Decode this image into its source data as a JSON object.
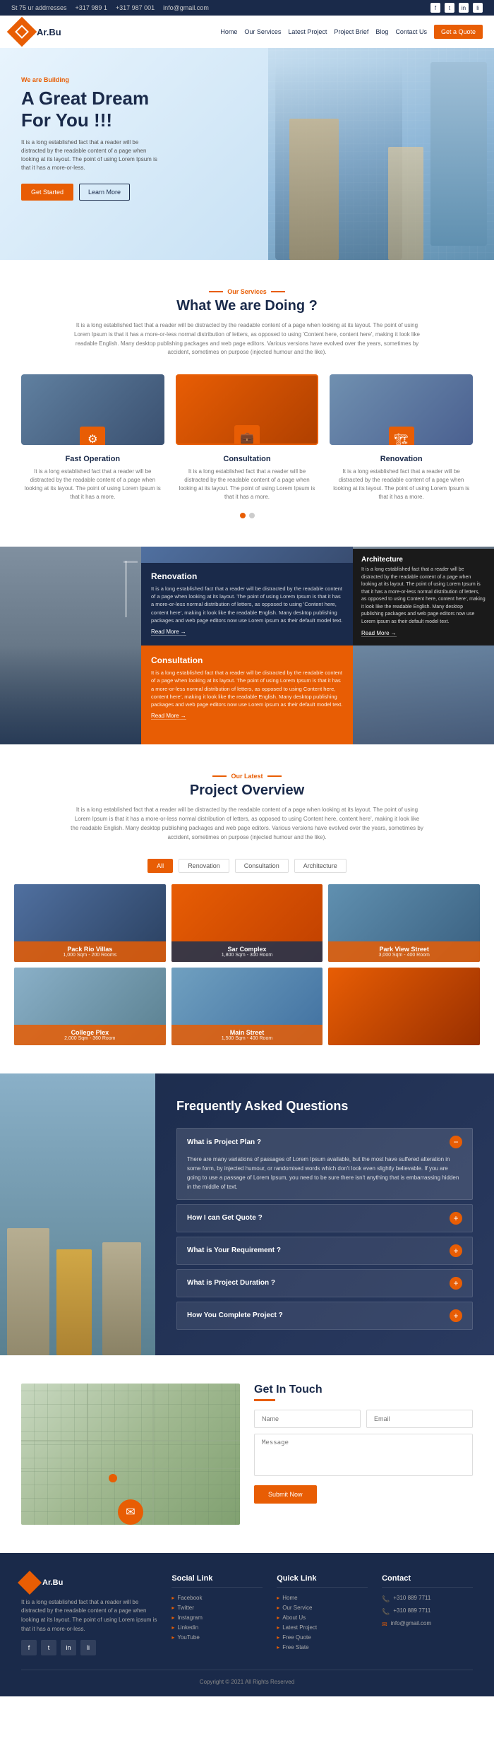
{
  "topbar": {
    "address": "St 75 ur addrresses",
    "phone1": "+317 989 1",
    "phone2": "+317 987 001",
    "email": "info@gmail.com"
  },
  "navbar": {
    "logo_text": "Ar.Bu",
    "links": [
      "Home",
      "Our Services",
      "Latest Project",
      "Project Brief",
      "Blog",
      "Contact Us"
    ],
    "cta_label": "Get a Quote"
  },
  "hero": {
    "tag": "We are Building",
    "title": "A Great Dream\nFor You !!!",
    "desc": "It is a long established fact that a reader will be distracted by the readable content of a page when looking at its layout. The point of using Lorem Ipsum is that it has a more-or-less.",
    "btn_primary": "Get Started",
    "btn_outline": "Learn More"
  },
  "services_section": {
    "tag": "Our Services",
    "title": "What We are Doing ?",
    "desc": "It is a long established fact that a reader will be distracted by the readable content of a page when looking at its layout. The point of using Lorem Ipsum is that it has a more-or-less normal distribution of letters, as opposed to using 'Content here, content here', making it look like readable English. Many desktop publishing packages and web page editors. Various versions have evolved over the years, sometimes by accident, sometimes on purpose (injected humour and the like).",
    "cards": [
      {
        "name": "Fast Operation",
        "text": "It is a long established fact that a reader will be distracted by the readable content of a page when looking at its layout. The point of using Lorem Ipsum is that it has a more.",
        "icon": "⚙"
      },
      {
        "name": "Consultation",
        "text": "It is a long established fact that a reader will be distracted by the readable content of a page when looking at its layout. The point of using Lorem Ipsum is that it has a more.",
        "icon": "💼"
      },
      {
        "name": "Renovation",
        "text": "It is a long established fact that a reader will be distracted by the readable content of a page when looking at its layout. The point of using Lorem Ipsum is that it has a more.",
        "icon": "🏗"
      }
    ]
  },
  "featured": {
    "items": [
      {
        "title": "Renovation",
        "text": "It is a long established fact that a reader will be distracted by the readable content of a page when looking at its layout. The point of using Lorem Ipsum is that it has a more-or-less normal distribution of letters, as opposed to using 'Content here, content here', making it look like the readable English. Many desktop publishing packages and web page editors now use Lorem ipsum as their default model text.",
        "readmore": "Read More"
      },
      {
        "title": "Consultation",
        "text": "It is a long established fact that a reader will be distracted by the readable content of a page when looking at its layout. The point of using Lorem Ipsum is that it has a more-or-less normal distribution of letters, as opposed to using Content here, content here', making it look like the readable English. Many desktop publishing packages and web page editors now use Lorem ipsum as their default model text.",
        "readmore": "Read More"
      },
      {
        "title": "Architecture",
        "text": "It is a long established fact that a reader will be distracted by the readable content of a page when looking at its layout. The point of using Lorem Ipsum is that it has a more-or-less normal distribution of letters, as opposed to using Content here, content here', making it look like the readable English. Many desktop publishing packages and web page editors now use Lorem ipsum as their default model text.",
        "readmore": "Read More"
      }
    ]
  },
  "projects_section": {
    "tag": "Our Latest",
    "title": "Project Overview",
    "desc": "It is a long established fact that a reader will be distracted by the readable content of a page when looking at its layout. The point of using Lorem Ipsum is that it has a more-or-less normal distribution of letters, as opposed to using Content here, content here', making it look like the readable English. Many desktop publishing packages and web page editors. Various versions have evolved over the years, sometimes by accident, sometimes on purpose (injected humour and the like).",
    "filter_tabs": [
      "All",
      "Renovation",
      "Consultation",
      "Architecture"
    ],
    "projects": [
      {
        "name": "Pack Rio Villas",
        "info": "1,000 Sqm - 200 Rooms"
      },
      {
        "name": "Sar Complex",
        "info": "1,800 Sqm - 300 Room"
      },
      {
        "name": "Park View Street",
        "info": "3,000 Sqm - 400 Room"
      },
      {
        "name": "College Plex",
        "info": "2,000 Sqm - 360 Room"
      },
      {
        "name": "Main Street",
        "info": "1,500 Sqm - 400 Room"
      },
      {
        "name": "",
        "info": ""
      }
    ]
  },
  "faq_section": {
    "title": "Frequently Asked Questions",
    "items": [
      {
        "question": "What is Project Plan ?",
        "answer": "There are many variations of passages of Lorem Ipsum available, but the most have suffered alteration in some form, by injected humour, or randomised words which don't look even slightly believable. If you are going to use a passage of Lorem Ipsum, you need to be sure there isn't anything that is embarrassing hidden in the middle of text.",
        "open": true
      },
      {
        "question": "How I can Get Quote ?",
        "answer": "",
        "open": false
      },
      {
        "question": "What is Your Requirement ?",
        "answer": "",
        "open": false
      },
      {
        "question": "What is Project Duration ?",
        "answer": "",
        "open": false
      },
      {
        "question": "How You Complete Project ?",
        "answer": "",
        "open": false
      }
    ]
  },
  "contact_section": {
    "title": "Get In Touch",
    "form": {
      "name_placeholder": "Name",
      "email_placeholder": "Email",
      "message_placeholder": "Message",
      "submit_label": "Submit Now"
    }
  },
  "footer": {
    "logo_text": "Ar.Bu",
    "desc": "It is a long established fact that a reader will be distracted by the readable content of a page when looking at its layout. The point of using Lorem ipsum is that it has a more-or-less.",
    "social_links_title": "Social Link",
    "social_links": [
      "Facebook",
      "Twitter",
      "Instagram",
      "Linkedin",
      "YouTube"
    ],
    "quick_links_title": "Quick Link",
    "quick_links": [
      "Home",
      "Our Service",
      "About Us",
      "Latest Project",
      "Free Quote",
      "Free State"
    ],
    "contact_title": "Contact",
    "contact_items": [
      "+310 889 7711",
      "+310 889 7711",
      "info@gmail.com"
    ],
    "copyright": "Copyright © 2021 All Rights Reserved"
  }
}
